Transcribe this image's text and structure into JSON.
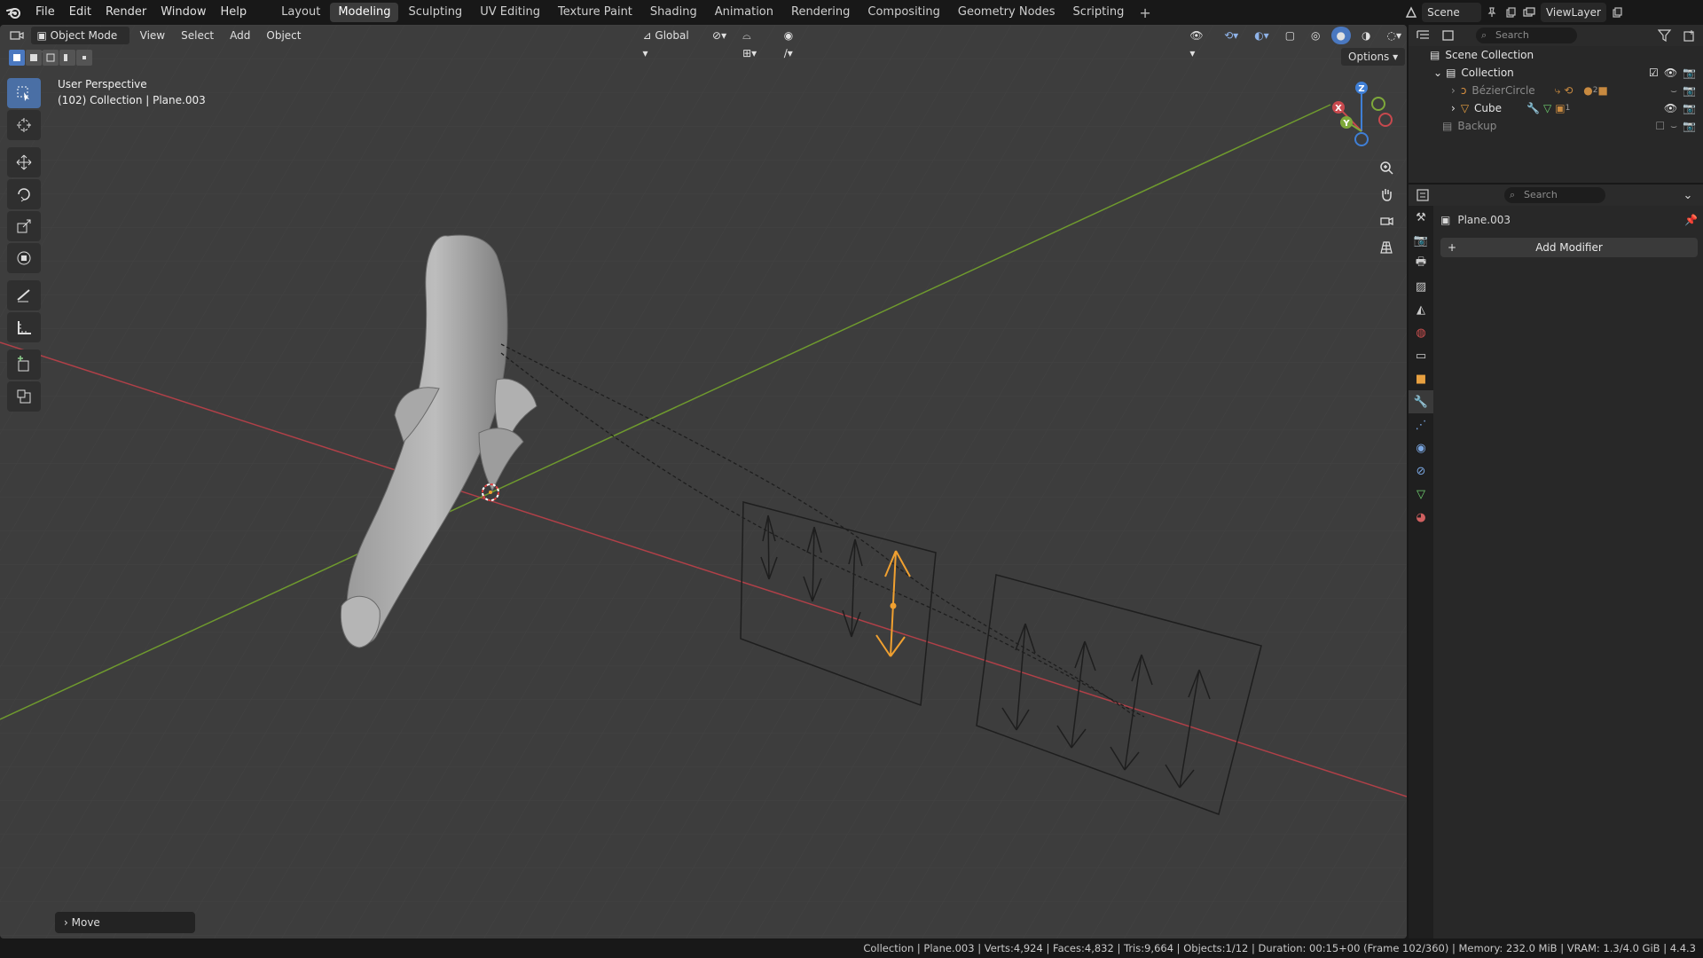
{
  "menu": [
    "File",
    "Edit",
    "Render",
    "Window",
    "Help"
  ],
  "workspaces": [
    "Layout",
    "Modeling",
    "Sculpting",
    "UV Editing",
    "Texture Paint",
    "Shading",
    "Animation",
    "Rendering",
    "Compositing",
    "Geometry Nodes",
    "Scripting"
  ],
  "active_workspace": "Modeling",
  "scene_name": "Scene",
  "view_layer": "ViewLayer",
  "viewport": {
    "mode": "Object Mode",
    "menus": [
      "View",
      "Select",
      "Add",
      "Object"
    ],
    "transform_orientation": "Global",
    "view_name": "User Perspective",
    "context_line": "(102) Collection | Plane.003",
    "options_label": "Options",
    "gizmo_axes": {
      "x": "X",
      "y": "Y",
      "z": "Z"
    },
    "last_operator": "Move"
  },
  "outliner": {
    "search_placeholder": "Search",
    "rows": [
      {
        "label": "Scene Collection"
      },
      {
        "label": "Collection"
      },
      {
        "label": "BézierCircle"
      },
      {
        "label": "Cube"
      },
      {
        "label": "Backup"
      }
    ],
    "badge_2": "2",
    "badge_1": "1"
  },
  "properties": {
    "search_placeholder": "Search",
    "object_name": "Plane.003",
    "add_modifier_label": "Add Modifier"
  },
  "status_text": "Collection | Plane.003 | Verts:4,924 | Faces:4,832 | Tris:9,664 | Objects:1/12 | Duration: 00:15+00 (Frame 102/360) | Memory: 232.0 MiB | VRAM: 1.3/4.0 GiB | 4.4.3",
  "colors": {
    "accent": "#4a78c0",
    "x_axis": "#c8494e",
    "y_axis": "#7ea83a",
    "z_axis": "#3f7fd6",
    "selection": "#f0a030"
  }
}
